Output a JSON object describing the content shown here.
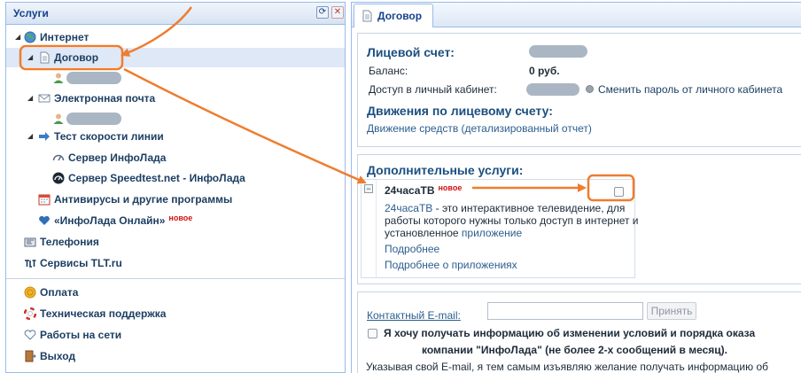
{
  "left": {
    "title": "Услуги",
    "tree": [
      {
        "key": "internet",
        "label": "Интернет"
      },
      {
        "key": "contract",
        "label": "Договор"
      },
      {
        "key": "email",
        "label": "Электронная почта"
      },
      {
        "key": "speedtest",
        "label": "Тест скорости линии"
      },
      {
        "key": "server_infolada",
        "label": "Сервер ИнфоЛада"
      },
      {
        "key": "server_speedtest",
        "label": "Сервер Speedtest.net - ИнфоЛада"
      },
      {
        "key": "antivirus",
        "label": "Антивирусы и другие программы"
      },
      {
        "key": "online",
        "label": "«ИнфоЛада Онлайн»",
        "badge": "новое"
      },
      {
        "key": "telephony",
        "label": "Телефония"
      },
      {
        "key": "tlt",
        "label": "Сервисы TLT.ru"
      }
    ],
    "bottom": [
      {
        "key": "payment",
        "label": "Оплата"
      },
      {
        "key": "support",
        "label": "Техническая поддержка"
      },
      {
        "key": "network_works",
        "label": "Работы на сети"
      },
      {
        "key": "exit",
        "label": "Выход"
      }
    ]
  },
  "right": {
    "tab_label": "Договор",
    "account": {
      "title": "Лицевой счет:",
      "balance_label": "Баланс:",
      "balance_value": "0 руб.",
      "cabinet_label": "Доступ в личный кабинет:",
      "change_password_link": "Сменить пароль от личного кабинета"
    },
    "movements": {
      "title": "Движения по лицевому счету:",
      "link": "Движение средств (детализированный отчет)"
    },
    "extra": {
      "title": "Дополнительные услуги:",
      "service": {
        "name": "24часаТВ",
        "badge": "новое",
        "desc_link": "24часаТВ",
        "desc_line1": " - это интерактивное телевидение, для",
        "desc_line2": "работы которого нужны только доступ в интернет и",
        "desc_line3_prefix": "установленное ",
        "desc_line3_link": "приложение",
        "more_link": "Подробнее",
        "more_apps_link": "Подробнее о приложениях",
        "checked": false
      }
    },
    "email": {
      "label": "Контактный E-mail:",
      "value": "",
      "accept_button": "Принять",
      "consent_line1": "Я хочу получать информацию об изменении условий и порядка оказа",
      "consent_line2": "компании \"ИнфоЛада\" (не более 2-х сообщений в месяц).",
      "notice": "Указывая свой E-mail, я тем самым изъявляю желание получать информацию об"
    }
  },
  "colors": {
    "annotation_orange": "#ee7d2f",
    "link_blue": "#2b5d8f",
    "heading_blue": "#1b4f80",
    "badge_red": "#d51212"
  }
}
